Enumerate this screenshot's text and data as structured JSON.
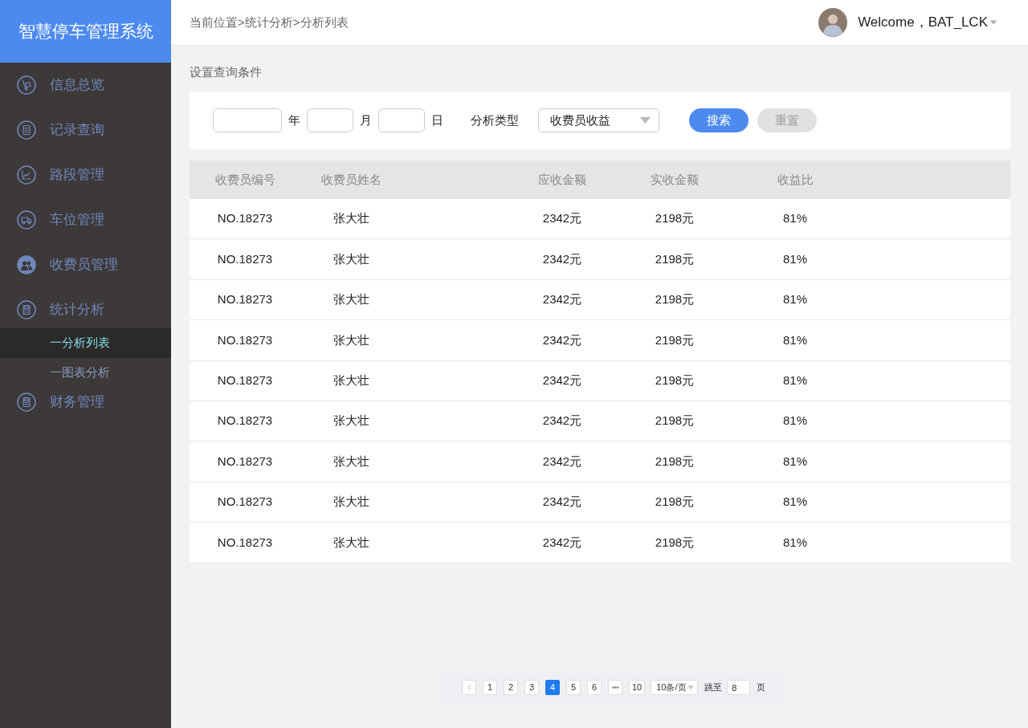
{
  "sidebar": {
    "title": "智慧停车管理系统",
    "items": [
      {
        "label": "信息总览",
        "selected": false
      },
      {
        "label": "记录查询",
        "selected": false
      },
      {
        "label": "路段管理",
        "selected": false
      },
      {
        "label": "车位管理",
        "selected": false
      },
      {
        "label": "收费员管理",
        "selected": false
      },
      {
        "label": "统计分析",
        "selected": false,
        "children": [
          {
            "label": "一分析列表",
            "selected": true
          },
          {
            "label": "一图表分析",
            "selected": false
          }
        ]
      },
      {
        "label": "财务管理",
        "selected": false
      }
    ]
  },
  "header": {
    "breadcrumb": "当前位置>统计分析>分析列表",
    "welcome": "Welcome，BAT_LCK"
  },
  "filter": {
    "title": "设置查询条件",
    "date_fields": [
      {
        "unit": "年"
      },
      {
        "unit": "月"
      },
      {
        "unit": "日"
      }
    ],
    "type_label": "分析类型",
    "type_value": "收费员收益",
    "buttons": [
      {
        "label": "搜索",
        "kind": "primary"
      },
      {
        "label": "重置",
        "kind": "secondary"
      }
    ]
  },
  "table": {
    "columns": [
      "收费员编号",
      "收费员姓名",
      "应收金额",
      "实收金额",
      "收益比"
    ],
    "rows": [
      [
        "NO.18273",
        "张大壮",
        "2342元",
        "2198元",
        "81%"
      ],
      [
        "NO.18273",
        "张大壮",
        "2342元",
        "2198元",
        "81%"
      ],
      [
        "NO.18273",
        "张大壮",
        "2342元",
        "2198元",
        "81%"
      ],
      [
        "NO.18273",
        "张大壮",
        "2342元",
        "2198元",
        "81%"
      ],
      [
        "NO.18273",
        "张大壮",
        "2342元",
        "2198元",
        "81%"
      ],
      [
        "NO.18273",
        "张大壮",
        "2342元",
        "2198元",
        "81%"
      ],
      [
        "NO.18273",
        "张大壮",
        "2342元",
        "2198元",
        "81%"
      ],
      [
        "NO.18273",
        "张大壮",
        "2342元",
        "2198元",
        "81%"
      ],
      [
        "NO.18273",
        "张大壮",
        "2342元",
        "2198元",
        "81%"
      ]
    ]
  },
  "pagination": {
    "pages": [
      {
        "label": "1",
        "kind": "page",
        "selected": false
      },
      {
        "label": "2",
        "kind": "page",
        "selected": false
      },
      {
        "label": "3",
        "kind": "page",
        "selected": false
      },
      {
        "label": "4",
        "kind": "page",
        "selected": true
      },
      {
        "label": "5",
        "kind": "page",
        "selected": false
      },
      {
        "label": "6",
        "kind": "page",
        "selected": false
      },
      {
        "label": "•••",
        "kind": "ellipsis",
        "selected": false
      },
      {
        "label": "10",
        "kind": "page",
        "selected": false
      }
    ],
    "page_size": "10条/页",
    "jump_label": "跳至",
    "jump_value": "8",
    "unit": "页"
  }
}
